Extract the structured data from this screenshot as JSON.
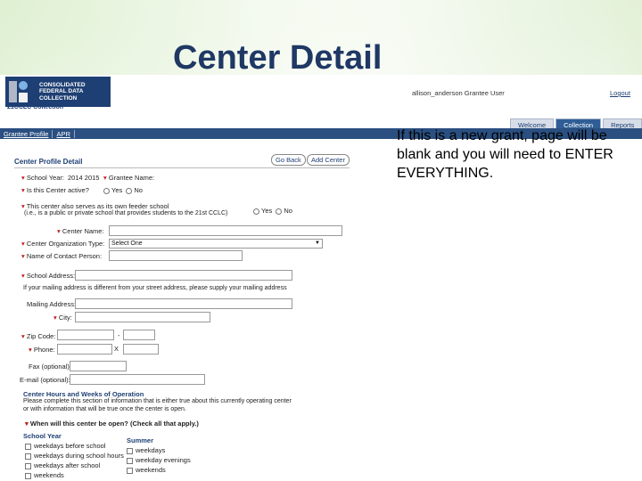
{
  "slide": {
    "title": "Center Detail",
    "callout": "If this is a new grant, page will be blank and you will need to ENTER EVERYTHING."
  },
  "header": {
    "logo_line1": "CONSOLIDATED",
    "logo_line2": "FEDERAL DATA",
    "logo_line3": "COLLECTION",
    "logo_sub": "21CCLC Collection",
    "user": "allison_anderson Grantee User",
    "logout": "Logout"
  },
  "tabs": [
    "Welcome",
    "Collection",
    "Reports"
  ],
  "active_tab": "Collection",
  "nav": [
    "Grantee Profile",
    "APR"
  ],
  "form": {
    "section_title": "Center Profile Detail",
    "go_back": "Go Back",
    "add_center": "Add Center",
    "school_year_label": "School Year:",
    "school_year_value": "2014 2015",
    "grantee_name_label": "Grantee Name:",
    "active_label": "Is this Center active?",
    "yes": "Yes",
    "no": "No",
    "feeder_label_1": "This center also serves as its own feeder school",
    "feeder_label_2": "(i.e., is a public or private school that provides students to the 21st CCLC)",
    "center_name_label": "Center Name:",
    "center_org_type_label": "Center Organization Type:",
    "center_org_type_value": "Select One",
    "contact_label": "Name of Contact Person:",
    "school_address_label": "School Address:",
    "mailing_note": "If your mailing address is different from your street address, please supply your mailing address",
    "mailing_address_label": "Mailing Address:",
    "city_label": "City:",
    "zip_label": "Zip Code:",
    "zip_dash": "-",
    "phone_label": "Phone:",
    "phone_ext": "X",
    "fax_label": "Fax (optional):",
    "email_label": "E-mail (optional):",
    "hours_title": "Center Hours and Weeks of Operation",
    "hours_note_1": "Please complete this section of information that is either true about this currently operating center",
    "hours_note_2": "or with information that will be true once the center is open.",
    "when_open": "When will this center be open? (Check all that apply.)",
    "school_year_col": "School Year",
    "summer_col": "Summer",
    "school_year_items": [
      "weekdays before school",
      "weekdays during school hours",
      "weekdays after school",
      "weekends"
    ],
    "summer_items": [
      "weekdays",
      "weekday evenings",
      "weekends"
    ]
  }
}
